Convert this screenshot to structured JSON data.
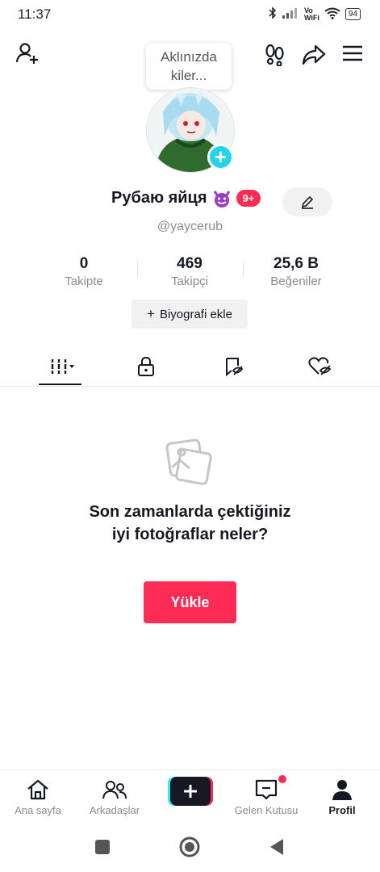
{
  "status_bar": {
    "time": "11:37",
    "network": "Vo\nWiFi",
    "battery": "94"
  },
  "header": {
    "bubble_text": "Aklınızda kiler..."
  },
  "profile": {
    "display_name": "Рубаю яйця",
    "notification_badge": "9+",
    "username": "@yaycerub",
    "stats": [
      {
        "value": "0",
        "label": "Takipte"
      },
      {
        "value": "469",
        "label": "Takipçi"
      },
      {
        "value": "25,6 B",
        "label": "Beğeniler"
      }
    ],
    "bio_button": "Biyografi ekle"
  },
  "content_tabs": [
    "videos-grid-icon",
    "lock-icon",
    "repost-icon",
    "liked-icon"
  ],
  "empty_state": {
    "message": "Son zamanlarda çektiğiniz iyi fotoğraflar neler?",
    "upload_button": "Yükle"
  },
  "bottom_nav": [
    {
      "label": "Ana sayfa",
      "icon": "home-icon"
    },
    {
      "label": "Arkadaşlar",
      "icon": "friends-icon"
    },
    {
      "label": "",
      "icon": "create-icon"
    },
    {
      "label": "Gelen Kutusu",
      "icon": "inbox-icon"
    },
    {
      "label": "Profil",
      "icon": "profile-icon"
    }
  ],
  "colors": {
    "accent": "#fe2c55",
    "cyan": "#20d5ec",
    "muted": "#8a8b91"
  }
}
